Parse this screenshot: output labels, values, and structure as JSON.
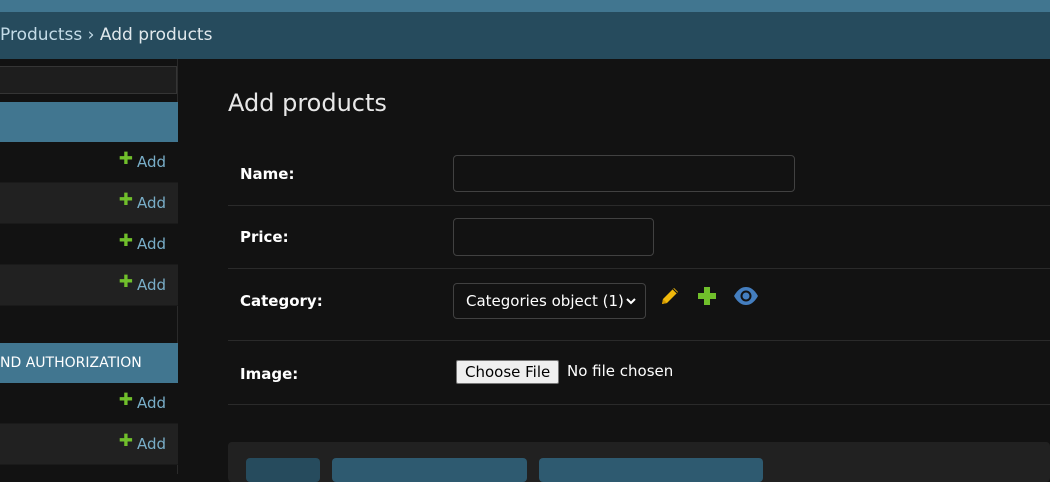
{
  "breadcrumb": {
    "parent": "Productss",
    "separator": "›",
    "current": "Add products"
  },
  "sidebar": {
    "section1": {
      "rows": [
        {
          "add_label": "Add"
        },
        {
          "add_label": "Add"
        },
        {
          "add_label": "Add"
        },
        {
          "add_label": "Add"
        }
      ]
    },
    "section2": {
      "title": "ND AUTHORIZATION",
      "rows": [
        {
          "add_label": "Add"
        },
        {
          "add_label": "Add"
        }
      ]
    }
  },
  "main": {
    "title": "Add products",
    "fields": {
      "name": {
        "label": "Name:",
        "value": ""
      },
      "price": {
        "label": "Price:",
        "value": ""
      },
      "category": {
        "label": "Category:",
        "selected": "Categories object (1)"
      },
      "image": {
        "label": "Image:",
        "button_label": "Choose File",
        "status": "No file chosen"
      }
    }
  },
  "colors": {
    "accent": "#417690",
    "breadcrumb_bg": "#264b5d",
    "link": "#79aec8",
    "add_icon": "#70bf2b",
    "edit_icon": "#f0b90b",
    "view_icon": "#447ebf"
  },
  "icons": {
    "add": "plus-icon",
    "edit": "pencil-icon",
    "view": "eye-icon",
    "select": "chevron-down-icon"
  }
}
